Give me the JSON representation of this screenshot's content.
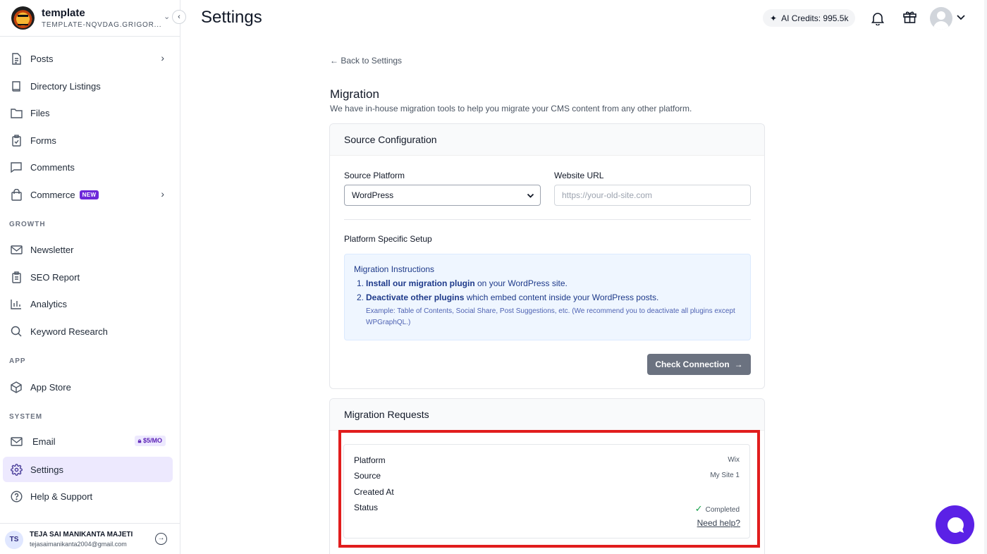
{
  "workspace": {
    "name": "template",
    "slug": "TEMPLATE-NQVDAG.GRIGOR..."
  },
  "nav": {
    "posts": "Posts",
    "directory": "Directory Listings",
    "files": "Files",
    "forms": "Forms",
    "comments": "Comments",
    "commerce": "Commerce",
    "commerce_badge": "NEW",
    "growth_label": "GROWTH",
    "newsletter": "Newsletter",
    "seo": "SEO Report",
    "analytics": "Analytics",
    "keyword": "Keyword Research",
    "app_label": "APP",
    "app_store": "App Store",
    "system_label": "SYSTEM",
    "email": "Email",
    "email_badge": "$5/MO",
    "settings": "Settings",
    "help": "Help & Support"
  },
  "user": {
    "initials": "TS",
    "name": "TEJA SAI MANIKANTA MAJETI",
    "email": "tejasaimanikanta2004@gmail.com"
  },
  "header": {
    "title": "Settings",
    "credits": "AI Credits: 995.5k"
  },
  "main": {
    "back": "Back to Settings",
    "title": "Migration",
    "subtitle": "We have in-house migration tools to help you migrate your CMS content from any other platform."
  },
  "source": {
    "heading": "Source Configuration",
    "platform_label": "Source Platform",
    "platform_value": "WordPress",
    "url_label": "Website URL",
    "url_placeholder": "https://your-old-site.com",
    "setup_label": "Platform Specific Setup",
    "instructions_title": "Migration Instructions",
    "step1_num": "1.",
    "step1_bold": "Install our migration plugin",
    "step1_rest": " on your WordPress site.",
    "step2_num": "2.",
    "step2_bold": "Deactivate other plugins",
    "step2_rest": " which embed content inside your WordPress posts.",
    "example": "Example: Table of Contents, Social Share, Post Suggestions, etc. (We recommend you to deactivate all plugins except WPGraphQL.)",
    "check_button": "Check Connection"
  },
  "requests": {
    "heading": "Migration Requests",
    "platform_label": "Platform",
    "platform_value": "Wix",
    "source_label": "Source",
    "source_value": "My Site 1",
    "created_label": "Created At",
    "status_label": "Status",
    "status_value": "Completed",
    "need_help": "Need help?"
  },
  "colors": {
    "accent": "#6d28d9",
    "active_bg": "#ede9fe",
    "highlight": "#e11d1d",
    "chat": "#5b21e6",
    "success": "#16a34a"
  }
}
